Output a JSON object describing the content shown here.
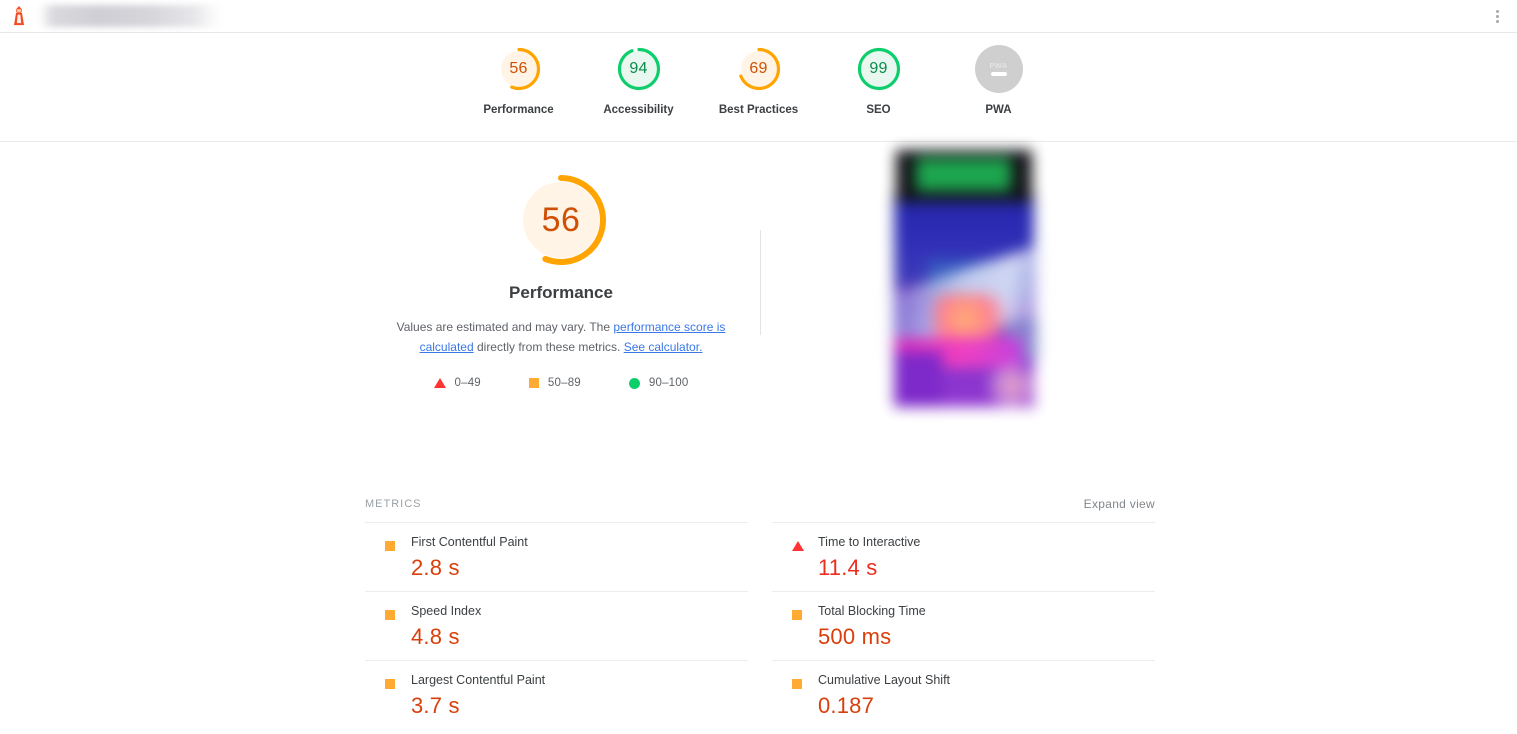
{
  "topbar": {
    "logo_icon": "lighthouse-icon",
    "url_placeholder": "",
    "menu_icon": "kebab-menu-icon"
  },
  "score_strip": {
    "items": [
      {
        "label": "Performance",
        "value": "56",
        "pct": 56,
        "color": "#ffa400",
        "fill": "#fff4e5",
        "text_color": "#cf5005",
        "rating": "average"
      },
      {
        "label": "Accessibility",
        "value": "94",
        "pct": 94,
        "color": "#0cce6b",
        "fill": "#e8f8f0",
        "text_color": "#0b8a4a",
        "rating": "good"
      },
      {
        "label": "Best Practices",
        "value": "69",
        "pct": 69,
        "color": "#ffa400",
        "fill": "#fff4e5",
        "text_color": "#cf5005",
        "rating": "average"
      },
      {
        "label": "SEO",
        "value": "99",
        "pct": 99,
        "color": "#0cce6b",
        "fill": "#e8f8f0",
        "text_color": "#0b8a4a",
        "rating": "good"
      },
      {
        "label": "PWA",
        "value": "PWA",
        "pct": 0,
        "color": "#cfcfcf",
        "fill": "#cfcfcf",
        "text_color": "#e4e4e4",
        "rating": "none"
      }
    ]
  },
  "performance": {
    "score": "56",
    "pct": 56,
    "title": "Performance",
    "gauge_color": "#ffa400",
    "gauge_fill": "#fff4e5",
    "score_color": "#cf5005",
    "description": {
      "part1": "Values are estimated and may vary. The ",
      "link1": "performance score is calculated",
      "part2": " directly from these metrics. ",
      "link2": "See calculator."
    },
    "legend": [
      {
        "icon": "triangle",
        "range": "0–49",
        "color": "#f33"
      },
      {
        "icon": "square",
        "range": "50–89",
        "color": "#fa3"
      },
      {
        "icon": "circle",
        "range": "90–100",
        "color": "#0cce6b"
      }
    ]
  },
  "screenshot_thumb": {
    "alt": "page-screenshot-thumbnail",
    "blurred": true
  },
  "metrics": {
    "title": "METRICS",
    "expand_label": "Expand view",
    "left_column": [
      {
        "name": "First Contentful Paint",
        "value": "2.8 s",
        "rating": "average",
        "icon": "square",
        "value_color": "#d93f0b"
      },
      {
        "name": "Speed Index",
        "value": "4.8 s",
        "rating": "average",
        "icon": "square",
        "value_color": "#d93f0b"
      },
      {
        "name": "Largest Contentful Paint",
        "value": "3.7 s",
        "rating": "average",
        "icon": "square",
        "value_color": "#d93f0b"
      }
    ],
    "right_column": [
      {
        "name": "Time to Interactive",
        "value": "11.4 s",
        "rating": "poor",
        "icon": "triangle",
        "value_color": "#eb2d20"
      },
      {
        "name": "Total Blocking Time",
        "value": "500 ms",
        "rating": "average",
        "icon": "square",
        "value_color": "#d93f0b"
      },
      {
        "name": "Cumulative Layout Shift",
        "value": "0.187",
        "rating": "average",
        "icon": "square",
        "value_color": "#d93f0b"
      }
    ]
  }
}
